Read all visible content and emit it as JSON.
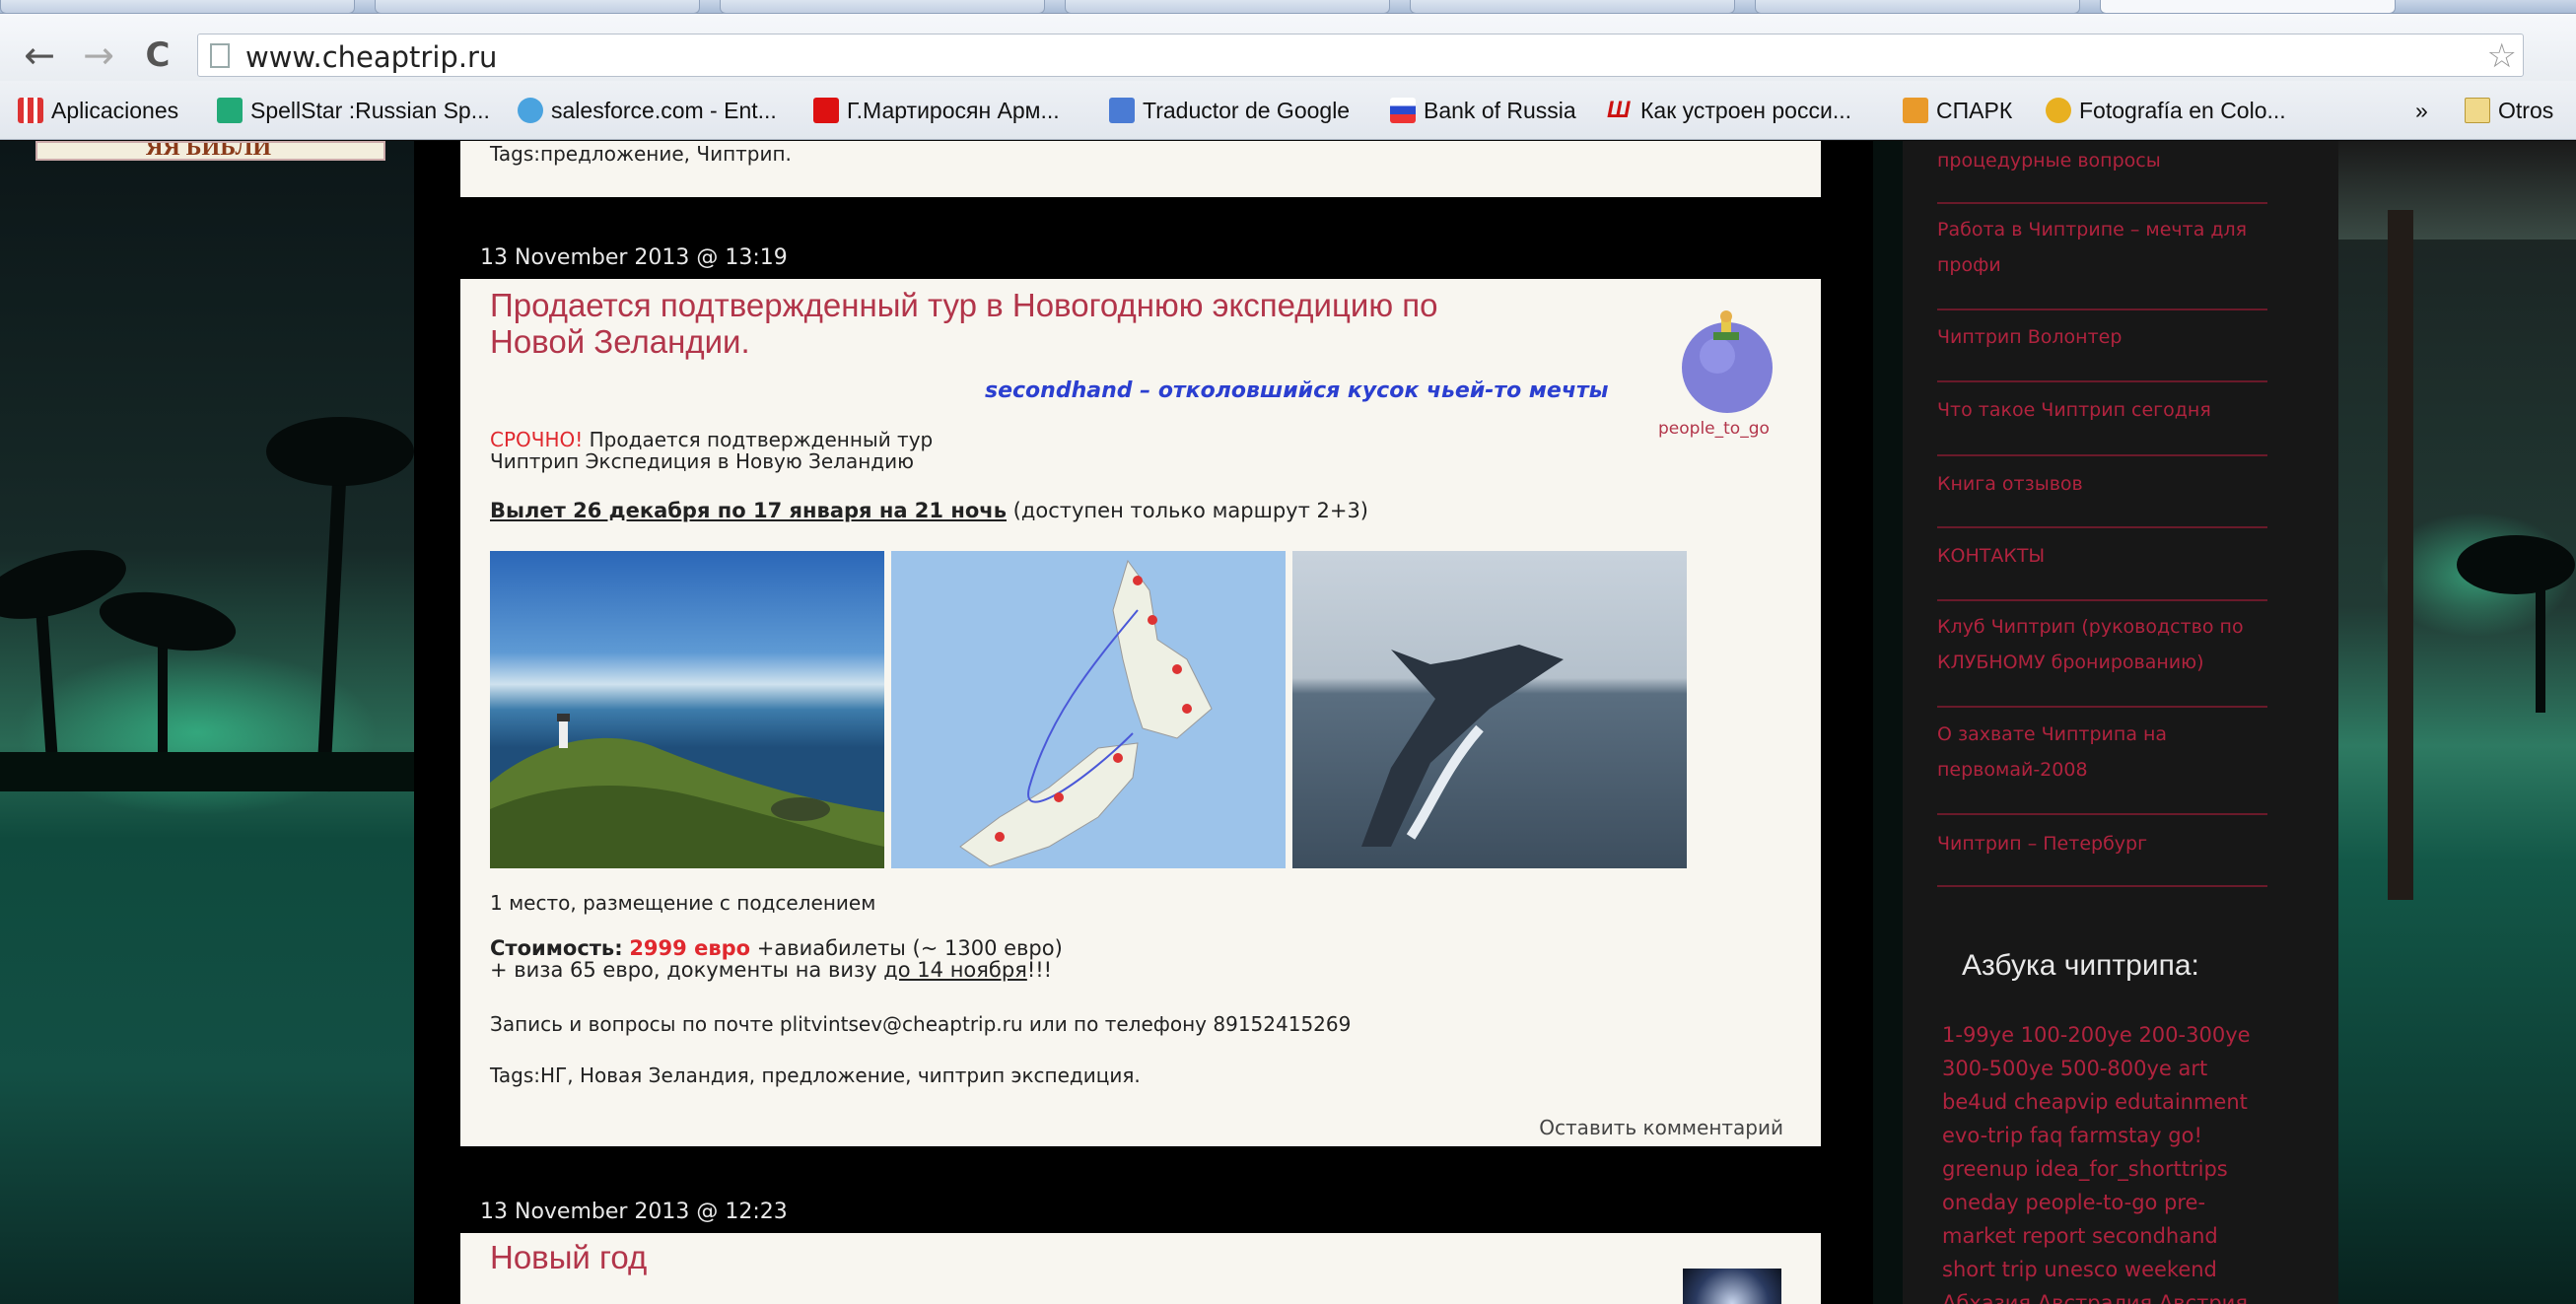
{
  "browser": {
    "url": "www.cheaptrip.ru",
    "bookmarks": [
      {
        "label": "Aplicaciones",
        "color": "#d33"
      },
      {
        "label": "SpellStar :Russian Sp...",
        "color": "#2a7"
      },
      {
        "label": "salesforce.com - Ent...",
        "color": "#4aa3df"
      },
      {
        "label": "Г.Мартиросян Арм...",
        "color": "#d11"
      },
      {
        "label": "Traductor de Google",
        "color": "#4a7bd4"
      },
      {
        "label": "Bank of Russia",
        "color": "#e33"
      },
      {
        "label": "Как устроен росси...",
        "color": "#c11"
      },
      {
        "label": "СПАРК",
        "color": "#e99a2a"
      },
      {
        "label": "Fotografía en Colo...",
        "color": "#e8b020"
      }
    ],
    "bookmarks_more": "»",
    "other_bookmarks": "Otros"
  },
  "logo_text": "ЯЯ БИБЛИ",
  "prev_post": {
    "tags": "Tags:предложение, Чиптрип."
  },
  "post1": {
    "date": "13 November 2013 @ 13:19",
    "title_line1": "Продается подтвержденный тур в Новогоднюю экспедицию по",
    "title_line2": "Новой Зеландии.",
    "tagline": "secondhand – отколовшийся кусок чьей-то мечты",
    "avatar_caption": "people_to_go",
    "urgent": "СРОЧНО!",
    "intro_rest": " Продается подтвержденный тур",
    "intro_line2": "Чиптрип Экспедиция в Новую Зеландию",
    "flight": "Вылет 26 декабря по 17 января на 21 ночь",
    "flight_note": " (доступен только маршрут 2+3)",
    "accommodation": "1 место, размещение с подселением",
    "cost_label": "Стоимость:",
    "cost_value": "2999 евро",
    "cost_rest": " +авиабилеты (~ 1300 евро)",
    "visa_prefix": "+ виза 65 евро, документы на визу ",
    "visa_link": "до 14 ноября",
    "visa_suffix": "!!!",
    "contact": "Запись и вопросы по почте plitvintsev@cheaptrip.ru или по телефону 89152415269",
    "tags": "Tags:НГ, Новая Зеландия, предложение, чиптрип экспедиция.",
    "comment_link": "Оставить комментарий"
  },
  "post2": {
    "date": "13 November 2013 @ 12:23",
    "title": "Новый год"
  },
  "sidebar": {
    "items": [
      "процедурные вопросы",
      "Работа в Чиптрипе – мечта для профи",
      "Чиптрип Волонтер",
      "Что такое Чиптрип сегодня",
      "Книга отзывов",
      "КОНТАКТЫ",
      "Клуб Чиптрип (руководство по КЛУБНОМУ бронированию)",
      "О захвате Чиптрипа на первомай-2008",
      "Чиптрип – Петербург"
    ],
    "abc_title": "Азбука чиптрипа:",
    "abc_tags": "1-99уе 100-200уе 200-300уе 300-500уе 500-800уе art be4ud cheapvip edutainment evo-trip faq farmstay go! greenup idea_for_shorttrips oneday people-to-go pre-market report secondhand short trip unesco weekend Абхазия Австралия Австрия"
  },
  "colors": {
    "accent": "#b2354a",
    "sidebar_link": "#b0233e",
    "price": "#e0282e",
    "tagline": "#2b3fd0"
  }
}
